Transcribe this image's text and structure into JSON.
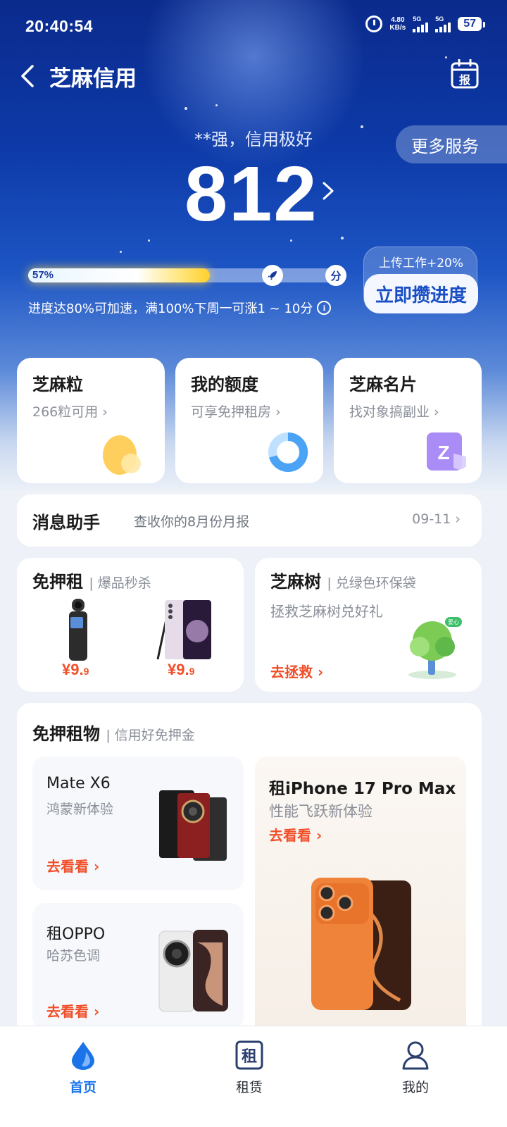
{
  "status_bar": {
    "time": "20:40:54",
    "net_speed_value": "4.80",
    "net_speed_unit": "KB/s",
    "signal1": "5G",
    "signal2": "5G",
    "battery": "57"
  },
  "header": {
    "title": "芝麻信用",
    "report_icon_text": "报"
  },
  "more_services": "更多服务",
  "score": {
    "subtitle": "**强，信用极好",
    "value": "812"
  },
  "progress": {
    "percent_label": "57%",
    "value": 0.57,
    "end_badge": "分",
    "note": "进度达80%可加速，满100%下周一可涨1 ~ 10分"
  },
  "boost": {
    "label": "上传工作+20%",
    "button": "立即攒进度"
  },
  "feature_cards": [
    {
      "title": "芝麻粒",
      "subtitle": "266粒可用"
    },
    {
      "title": "我的额度",
      "subtitle": "可享免押租房"
    },
    {
      "title": "芝麻名片",
      "subtitle": "找对象搞副业"
    }
  ],
  "message": {
    "title": "消息助手",
    "text": "查收你的8月份月报",
    "date": "09-11"
  },
  "promo_rent": {
    "title": "免押租",
    "tag": "| 爆品秒杀",
    "price1_main": "¥9.",
    "price1_small": "9",
    "price2_main": "¥9.",
    "price2_small": "9"
  },
  "promo_tree": {
    "title": "芝麻树",
    "tag": "| 兑绿色环保袋",
    "subtitle": "拯救芝麻树兑好礼",
    "link": "去拯救",
    "badge": "爱心"
  },
  "section": {
    "title": "免押租物",
    "tag": "| 信用好免押金",
    "products": [
      {
        "name": "Mate X6",
        "desc": "鸿蒙新体验",
        "link": "去看看"
      },
      {
        "name": "租OPPO",
        "desc": "哈苏色调",
        "link": "去看看"
      },
      {
        "name": "租iPhone 17 Pro Max",
        "desc": "性能飞跃新体验",
        "link": "去看看"
      }
    ]
  },
  "tabbar": {
    "tabs": [
      {
        "label": "首页"
      },
      {
        "label": "租赁",
        "icon_text": "租"
      },
      {
        "label": "我的"
      }
    ]
  },
  "colors": {
    "accent": "#1a73e8",
    "price": "#f0502a",
    "hero_top": "#0b2a8c"
  }
}
